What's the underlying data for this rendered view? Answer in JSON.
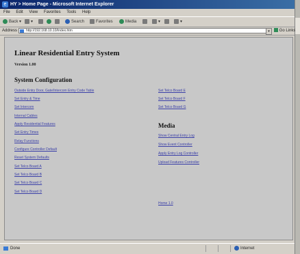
{
  "window": {
    "title": "HY > Home Page - Microsoft Internet Explorer"
  },
  "menu": [
    "File",
    "Edit",
    "View",
    "Favorites",
    "Tools",
    "Help"
  ],
  "toolbar": {
    "back": "Back",
    "search": "Search",
    "favorites": "Favorites",
    "media": "Media"
  },
  "address": {
    "label": "Address",
    "url": "http://192.168.10.10/Index.htm",
    "go": "Go",
    "links": "Links"
  },
  "page": {
    "title": "Linear Residential Entry System",
    "version": "Version 1.00",
    "section_config": "System Configuration",
    "section_media": "Media",
    "config_links_left": [
      "Outside Entry Door, Gate/Intercom Entry Code Table",
      "Set Entry & Time",
      "Set Intercom",
      "Internal Cables",
      "Apply Residential Features",
      "Set Entry Times",
      "Relay Functions",
      "Configure Controller Default",
      "Reset System Defaults",
      "Set Telco Board A",
      "Set Telco Board B",
      "Set Telco Board C",
      "Set Telco Board D"
    ],
    "config_links_right": [
      "Set Telco Board E",
      "Set Telco Board F",
      "Set Telco Board G"
    ],
    "media_links": [
      "Show Central Entry Log",
      "Show Event Controller",
      "Apply Entry Log Controller",
      "Upload Features Controller"
    ],
    "page_footer_link": "Home 1.0"
  },
  "status": {
    "text": "Done",
    "zone": "Internet"
  }
}
